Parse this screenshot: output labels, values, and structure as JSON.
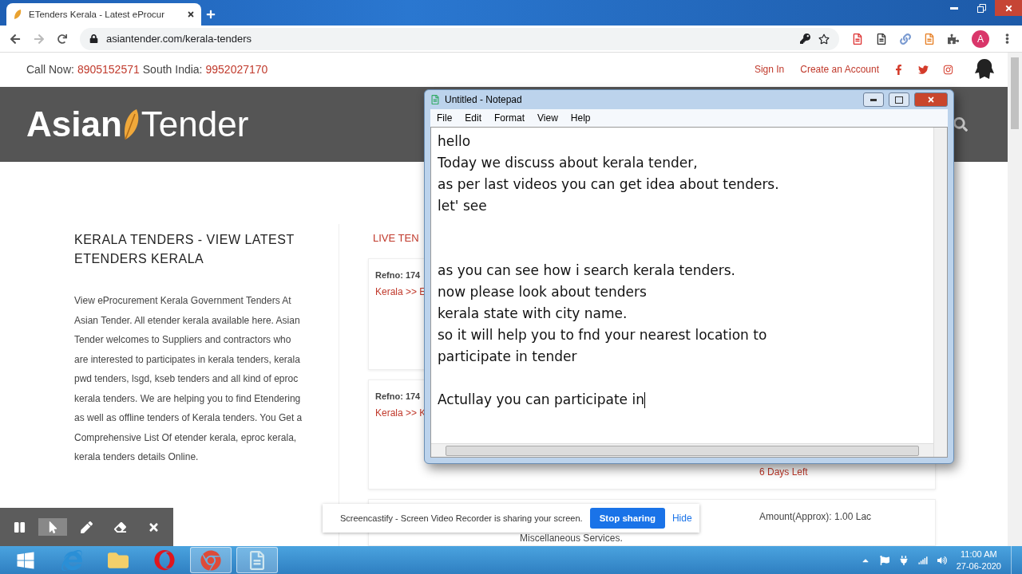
{
  "browser": {
    "tab_title": "ETenders Kerala - Latest eProcur",
    "url": "asiantender.com/kerala-tenders",
    "avatar_letter": "A"
  },
  "topbar": {
    "call_label": "Call Now:",
    "call_number": "8905152571",
    "south_label": "South India:",
    "south_number": "9952027170",
    "links": [
      "Sign In",
      "Create an Account"
    ]
  },
  "header": {
    "logo_left": "Asian",
    "logo_right": "Tender"
  },
  "intro": {
    "heading": "KERALA TENDERS - VIEW LATEST ETENDERS KERALA",
    "body": "View eProcurement Kerala Government Tenders At Asian Tender. All etender kerala available here. Asian Tender welcomes to Suppliers and contractors who are interested to participates in kerala tenders, kerala pwd tenders, lsgd, kseb tenders and all kind of eproc kerala tenders. We are helping you to find Etendering as well as offline tenders of Kerala tenders. You Get a Comprehensive List Of etender kerala, eproc kerala, kerala tenders details Online."
  },
  "live_tenders": {
    "heading": "LIVE TEN",
    "cards": [
      {
        "refno": "Refno: 174",
        "location": "Kerala >> E"
      },
      {
        "refno": "Refno: 174",
        "location": "Kerala >> K",
        "days_left": "6 Days Left"
      },
      {
        "category": "Miscellaneous Services.",
        "amount": "Amount(Approx): 1.00 Lac"
      }
    ]
  },
  "notepad": {
    "title": "Untitled - Notepad",
    "menu": [
      "File",
      "Edit",
      "Format",
      "View",
      "Help"
    ],
    "lines": [
      {
        "kind": "text",
        "text": "hello"
      },
      {
        "kind": "text",
        "text": "Today we discuss about kerala tender,"
      },
      {
        "kind": "text",
        "text": "as per last videos you can get idea about tenders."
      },
      {
        "kind": "text",
        "text": "let' see"
      },
      {
        "kind": "blank"
      },
      {
        "kind": "blank"
      },
      {
        "kind": "text",
        "text": "as you can see how i search kerala tenders."
      },
      {
        "kind": "text",
        "text": "now please look about tenders"
      },
      {
        "kind": "text",
        "text": "kerala state with city name."
      },
      {
        "kind": "text",
        "text": "so it will help you to fnd your nearest location to"
      },
      {
        "kind": "text",
        "text": "participate in tender"
      },
      {
        "kind": "blank"
      },
      {
        "kind": "text",
        "text": "Actullay you can participate in"
      }
    ]
  },
  "screencastify": {
    "message": "Screencastify - Screen Video Recorder is sharing your screen.",
    "stop": "Stop sharing",
    "hide": "Hide"
  },
  "annotation_toolbar": {
    "tools": [
      {
        "kind": "pause",
        "selected": false
      },
      {
        "kind": "pointer",
        "selected": true
      },
      {
        "kind": "pen",
        "selected": false
      },
      {
        "kind": "eraser",
        "selected": false
      },
      {
        "kind": "close",
        "selected": false
      }
    ]
  },
  "taskbar": {
    "apps": [
      {
        "kind": "ie",
        "active": false
      },
      {
        "kind": "explorer",
        "active": false
      },
      {
        "kind": "opera",
        "active": false
      },
      {
        "kind": "chrome",
        "active": true
      },
      {
        "kind": "notepad",
        "active": true
      }
    ],
    "time": "11:00 AM",
    "date": "27-06-2020"
  }
}
